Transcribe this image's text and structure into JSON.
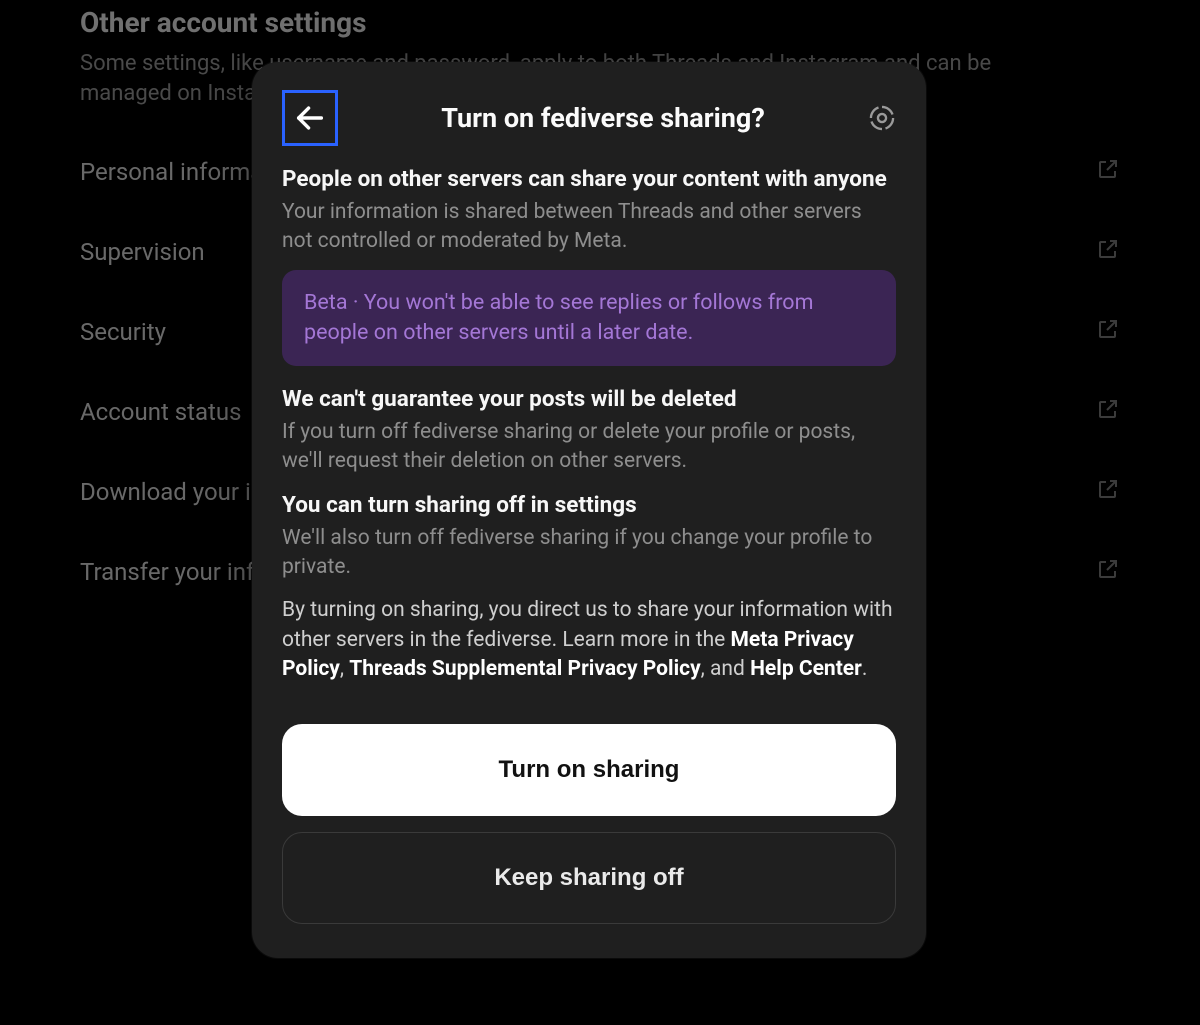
{
  "background": {
    "title": "Other account settings",
    "subtitle": "Some settings, like username and password, apply to both Threads and Instagram and can be managed on Instagram.",
    "items": [
      {
        "label": "Personal information"
      },
      {
        "label": "Supervision"
      },
      {
        "label": "Security"
      },
      {
        "label": "Account status"
      },
      {
        "label": "Download your information"
      },
      {
        "label": "Transfer your information"
      }
    ]
  },
  "modal": {
    "title": "Turn on fediverse sharing?",
    "section1_head": "People on other servers can share your content with anyone",
    "section1_body": "Your information is shared between Threads and other servers not controlled or moderated by Meta.",
    "beta_text": "Beta · You won't be able to see replies or follows from people on other servers until a later date.",
    "section2_head": "We can't guarantee your posts will be deleted",
    "section2_body": "If you turn off fediverse sharing or delete your profile or posts, we'll request their deletion on other servers.",
    "section3_head": "You can turn sharing off in settings",
    "section3_body": "We'll also turn off fediverse sharing if you change your profile to private.",
    "legal_pre": "By turning on sharing, you direct us to share your information with other servers in the fediverse. Learn more in the ",
    "link1": "Meta Privacy Policy",
    "legal_mid1": ", ",
    "link2": "Threads Supplemental Privacy Policy",
    "legal_mid2": ", and ",
    "link3": "Help Center",
    "legal_end": ".",
    "primary_btn": "Turn on sharing",
    "secondary_btn": "Keep sharing off"
  }
}
